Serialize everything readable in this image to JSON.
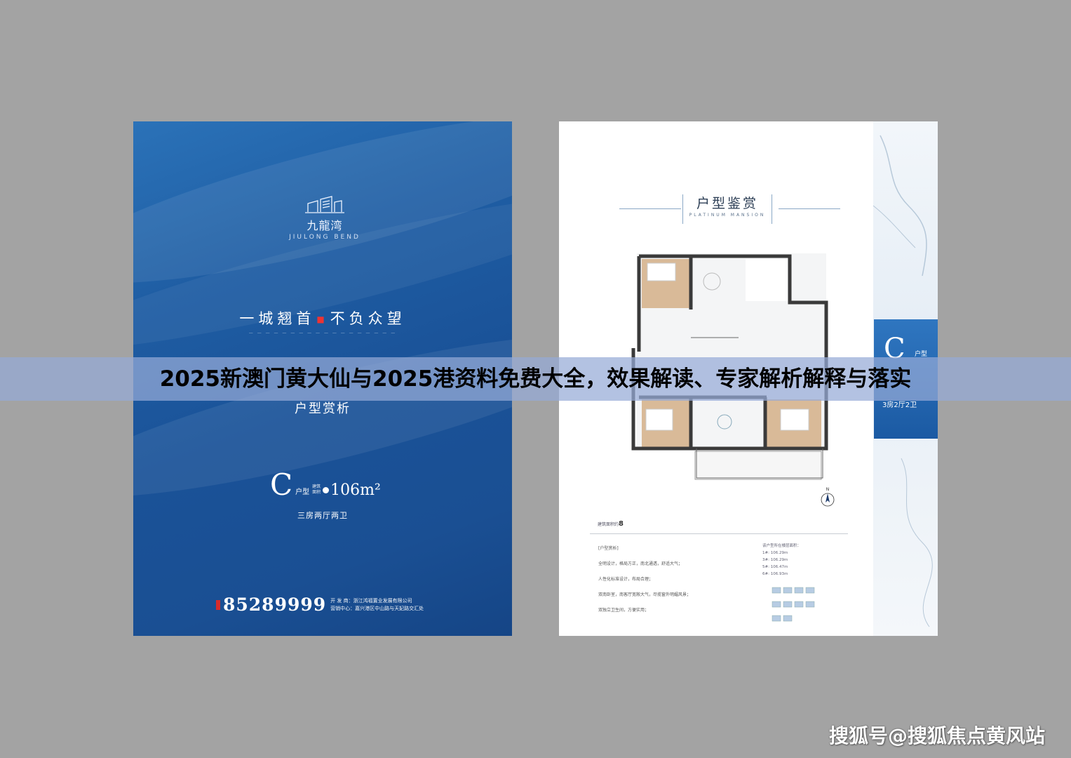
{
  "headline": "2025新澳门黄大仙与2025港资料免费大全，效果解读、专家解析解释与落实",
  "watermark": "搜狐号@搜狐焦点黄风站",
  "left_brochure": {
    "logo_cn": "九龍湾",
    "logo_en": "JIULONG BEND",
    "slogan_part1": "一城翘首",
    "slogan_part2": "不负众望",
    "subtitle": "户型赏析",
    "unit_letter": "C",
    "unit_type": "户型",
    "unit_area_label_1": "建筑",
    "unit_area_label_2": "面积",
    "unit_area": "106m²",
    "rooms": "三房两厅两卫",
    "hotline": "85289999",
    "developer_label": "开 发 商：",
    "developer": "浙江鸿福置业发展有限公司",
    "sales_label": "营销中心：",
    "sales_address": "嘉兴港区中山路与天妃路交汇处"
  },
  "right_brochure": {
    "title": "户型鉴赏",
    "title_en": "PLATINUM MANSION",
    "tag_letter": "C",
    "tag_type": "户型",
    "tag_rooms": "3房2厅2卫",
    "area_label": "建筑面积约",
    "area_value": "8",
    "desc_title": "[户型赏析]",
    "desc_lines": [
      "全明设计，格局方正，南北通透，舒适大气；",
      "人性化标准设计，布局合理；",
      "双南卧室，南客厅宽敞大气，尽揽窗外明媚风景；",
      "双独立卫生间，方便实用；"
    ],
    "stats_title": "该户型所在楼层面积：",
    "stats_lines": [
      "1#: 106.29m",
      "3#: 106.29m",
      "5#: 106.47m",
      "6#: 106.93m"
    ],
    "compass_label": "N"
  }
}
